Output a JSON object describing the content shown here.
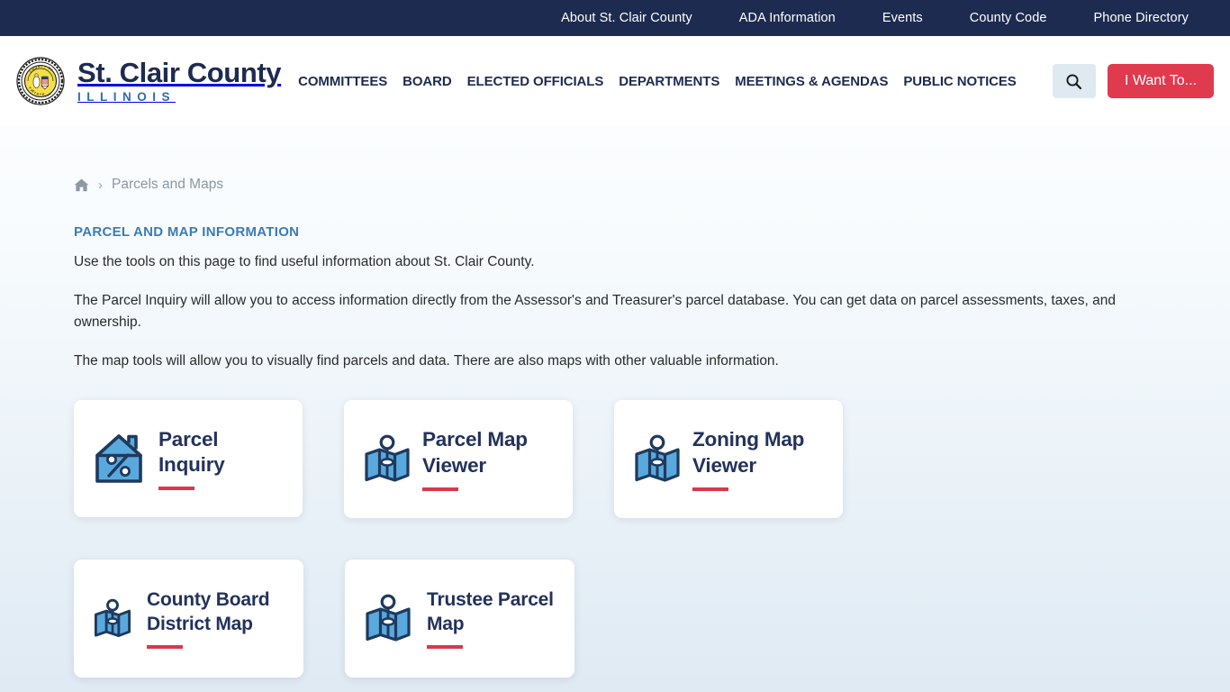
{
  "topbar": {
    "links": [
      {
        "label": "About St. Clair County"
      },
      {
        "label": "ADA Information"
      },
      {
        "label": "Events"
      },
      {
        "label": "County Code"
      },
      {
        "label": "Phone Directory"
      }
    ]
  },
  "header": {
    "brand_title": "St. Clair County",
    "brand_subtitle": "ILLINOIS",
    "seal_alt": "county-seal",
    "nav": [
      {
        "label": "COMMITTEES"
      },
      {
        "label": "BOARD"
      },
      {
        "label": "ELECTED OFFICIALS"
      },
      {
        "label": "DEPARTMENTS"
      },
      {
        "label": "MEETINGS & AGENDAS"
      },
      {
        "label": "PUBLIC NOTICES"
      }
    ],
    "search_label": "search-icon",
    "i_want_to_label": "I Want To..."
  },
  "breadcrumb": {
    "home_label": "Home",
    "separator": "›",
    "current": "Parcels and Maps"
  },
  "main": {
    "section_title": "PARCEL AND MAP INFORMATION",
    "paragraph_1": "Use the tools on this page to find useful information about St. Clair County.",
    "paragraph_2": "The Parcel Inquiry will allow you to access information directly from the Assessor's and Treasurer's parcel database. You can get data on parcel assessments, taxes, and ownership.",
    "paragraph_3": "The map tools will allow you to visually find parcels and data. There are also maps with other valuable information.",
    "cards": [
      {
        "title": "Parcel Inquiry",
        "icon": "house-percent-icon"
      },
      {
        "title": "Parcel Map Viewer",
        "icon": "map-pin-icon"
      },
      {
        "title": "Zoning Map Viewer",
        "icon": "map-pin-icon"
      },
      {
        "title": "County Board District Map",
        "icon": "map-pin-icon"
      },
      {
        "title": "Trustee Parcel Map",
        "icon": "map-pin-icon"
      }
    ]
  },
  "colors": {
    "navy": "#1e2b50",
    "accent_red": "#e03a4e",
    "rule_red": "#d9384b",
    "link_blue": "#3a7cb8",
    "icon_blue": "#5aa9dd",
    "icon_outline": "#1e3a5f",
    "seal_yellow": "#f4df4a"
  }
}
